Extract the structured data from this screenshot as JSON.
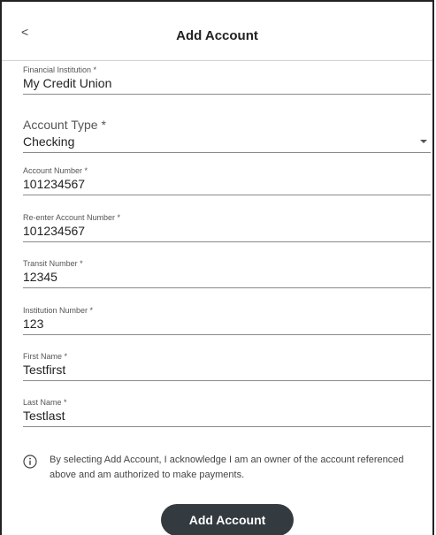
{
  "header": {
    "back_label": "<",
    "title": "Add Account"
  },
  "form": {
    "financial_institution": {
      "label": "Financial Institution *",
      "value": "My Credit Union"
    },
    "account_type": {
      "label": "Account Type *",
      "value": "Checking"
    },
    "account_number": {
      "label": "Account Number *",
      "value": "101234567"
    },
    "reenter_account_number": {
      "label": "Re-enter Account Number *",
      "value": "101234567"
    },
    "transit_number": {
      "label": "Transit Number *",
      "value": "12345"
    },
    "institution_number": {
      "label": "Institution Number *",
      "value": "123"
    },
    "first_name": {
      "label": "First Name *",
      "value": "Testfirst"
    },
    "last_name": {
      "label": "Last Name *",
      "value": "Testlast"
    }
  },
  "notice": {
    "icon": "info-icon",
    "text": "By selecting Add Account, I acknowledge I am an owner of the account referenced above and am authorized to make payments."
  },
  "actions": {
    "submit_label": "Add Account"
  },
  "colors": {
    "button_bg": "#333a40",
    "underline": "#8a8a8a"
  }
}
